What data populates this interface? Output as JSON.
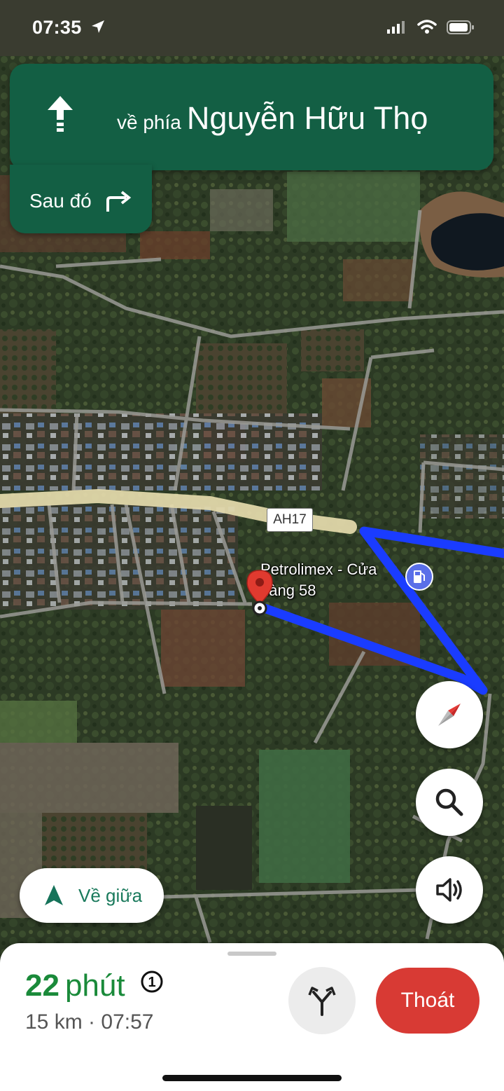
{
  "status_bar": {
    "time": "07:35",
    "icons": [
      "location-arrow-icon",
      "cellular-signal-icon",
      "wifi-icon",
      "battery-icon"
    ]
  },
  "navigation": {
    "direction_icon": "straight-arrow-icon",
    "prefix": "về phía",
    "street": "Nguyễn Hữu Thọ",
    "then_label": "Sau đó",
    "then_icon": "turn-right-icon",
    "card_color": "#135f44"
  },
  "map": {
    "road_label": "AH17",
    "poi_name_line1": "Petrolimex - Cửa",
    "poi_name_line2": "hàng 58",
    "poi_icon": "gas-station-icon",
    "route_color": "#1a3cff",
    "pin_icon": "destination-pin-icon"
  },
  "controls": {
    "compass_icon": "compass-icon",
    "search_icon": "search-icon",
    "sound_icon": "speaker-icon",
    "recenter_label": "Về giữa",
    "recenter_icon": "navigation-arrow-icon"
  },
  "trip": {
    "eta_value": "22",
    "eta_unit": "phút",
    "stops_badge": "1",
    "distance": "15 km",
    "separator": "·",
    "arrival_time": "07:57",
    "alt_routes_icon": "alternate-routes-icon",
    "exit_label": "Thoát",
    "eta_color": "#1a8a3a",
    "exit_color": "#d83a34"
  }
}
